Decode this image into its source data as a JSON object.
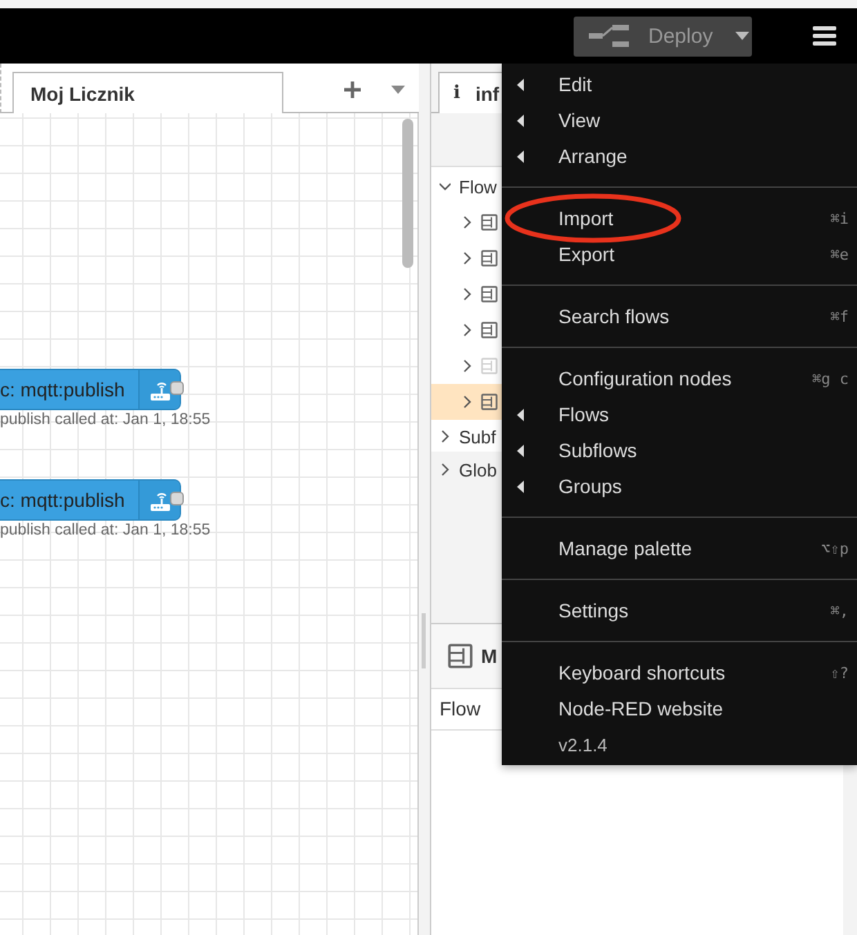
{
  "header": {
    "deploy": {
      "label": "Deploy",
      "disabled": true
    }
  },
  "workspace": {
    "tabs": [
      {
        "label": "Moj Licznik",
        "selected": true
      }
    ],
    "nodes": [
      {
        "label": "c: mqtt:publish",
        "status": "publish called at: Jan 1, 18:55"
      },
      {
        "label": "c: mqtt:publish",
        "status": "publish called at: Jan 1, 18:55"
      }
    ]
  },
  "sidebar": {
    "tab": {
      "icon": "i",
      "label": "inf",
      "selected": true
    },
    "tree": [
      {
        "label": "Flow",
        "expanded": true,
        "children": [
          {
            "selected": false,
            "disabled": false
          },
          {
            "selected": false,
            "disabled": false
          },
          {
            "selected": false,
            "disabled": false
          },
          {
            "selected": false,
            "disabled": false
          },
          {
            "selected": false,
            "disabled": true
          },
          {
            "selected": true,
            "disabled": false
          }
        ]
      },
      {
        "label": "Subf",
        "expanded": false
      },
      {
        "label": "Glob",
        "expanded": false
      }
    ],
    "panel": {
      "title": "M",
      "row": "Flow"
    }
  },
  "menu": {
    "groups": [
      [
        {
          "label": "Edit",
          "submenu": true
        },
        {
          "label": "View",
          "submenu": true
        },
        {
          "label": "Arrange",
          "submenu": true
        }
      ],
      [
        {
          "label": "Import",
          "shortcut": "⌘i",
          "circled": true
        },
        {
          "label": "Export",
          "shortcut": "⌘e"
        }
      ],
      [
        {
          "label": "Search flows",
          "shortcut": "⌘f"
        }
      ],
      [
        {
          "label": "Configuration nodes",
          "shortcut": "⌘g c"
        },
        {
          "label": "Flows",
          "submenu": true
        },
        {
          "label": "Subflows",
          "submenu": true
        },
        {
          "label": "Groups",
          "submenu": true
        }
      ],
      [
        {
          "label": "Manage palette",
          "shortcut": "⌥⇧p"
        }
      ],
      [
        {
          "label": "Settings",
          "shortcut": "⌘,"
        }
      ],
      [
        {
          "label": "Keyboard shortcuts",
          "shortcut": "⇧?"
        },
        {
          "label": "Node-RED website"
        },
        {
          "label": "v2.1.4",
          "kind": "version"
        }
      ]
    ]
  }
}
